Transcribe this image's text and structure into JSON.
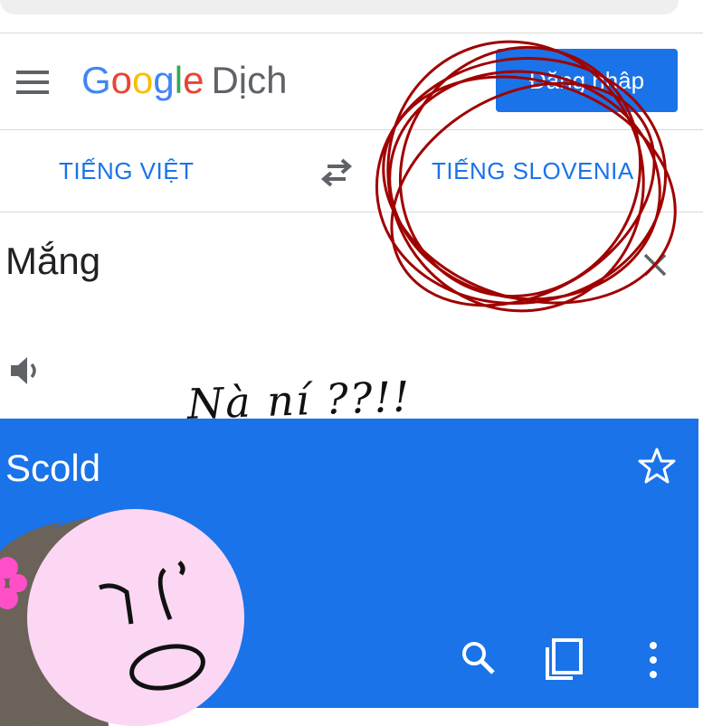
{
  "header": {
    "logo_google": [
      "G",
      "o",
      "o",
      "g",
      "l",
      "e"
    ],
    "logo_colors": [
      "#4285F4",
      "#EA4335",
      "#FBBC05",
      "#4285F4",
      "#34A853",
      "#EA4335"
    ],
    "logo_suffix": "Dịch",
    "signin_label": "Đăng nhập",
    "menu_icon": "hamburger-menu-icon"
  },
  "languages": {
    "source": "TIẾNG VIỆT",
    "target": "TIẾNG SLOVENIA",
    "swap_icon": "swap-arrows-icon"
  },
  "input": {
    "text": "Mắng",
    "clear_icon": "close-icon",
    "speaker_icon": "speaker-icon"
  },
  "result": {
    "text": "Scold",
    "star_icon": "star-outline-icon",
    "actions": [
      "search-icon",
      "copy-icon",
      "more-vert-icon"
    ],
    "panel_color": "#1a73e8"
  },
  "annotations": {
    "handwriting": "Nà ní ??!!",
    "circle_color": "#a00000",
    "sticker_face_color": "#fbd7f3",
    "sticker_hair_color": "#6b6259",
    "sticker_flower_color": "#ff4fc8"
  }
}
